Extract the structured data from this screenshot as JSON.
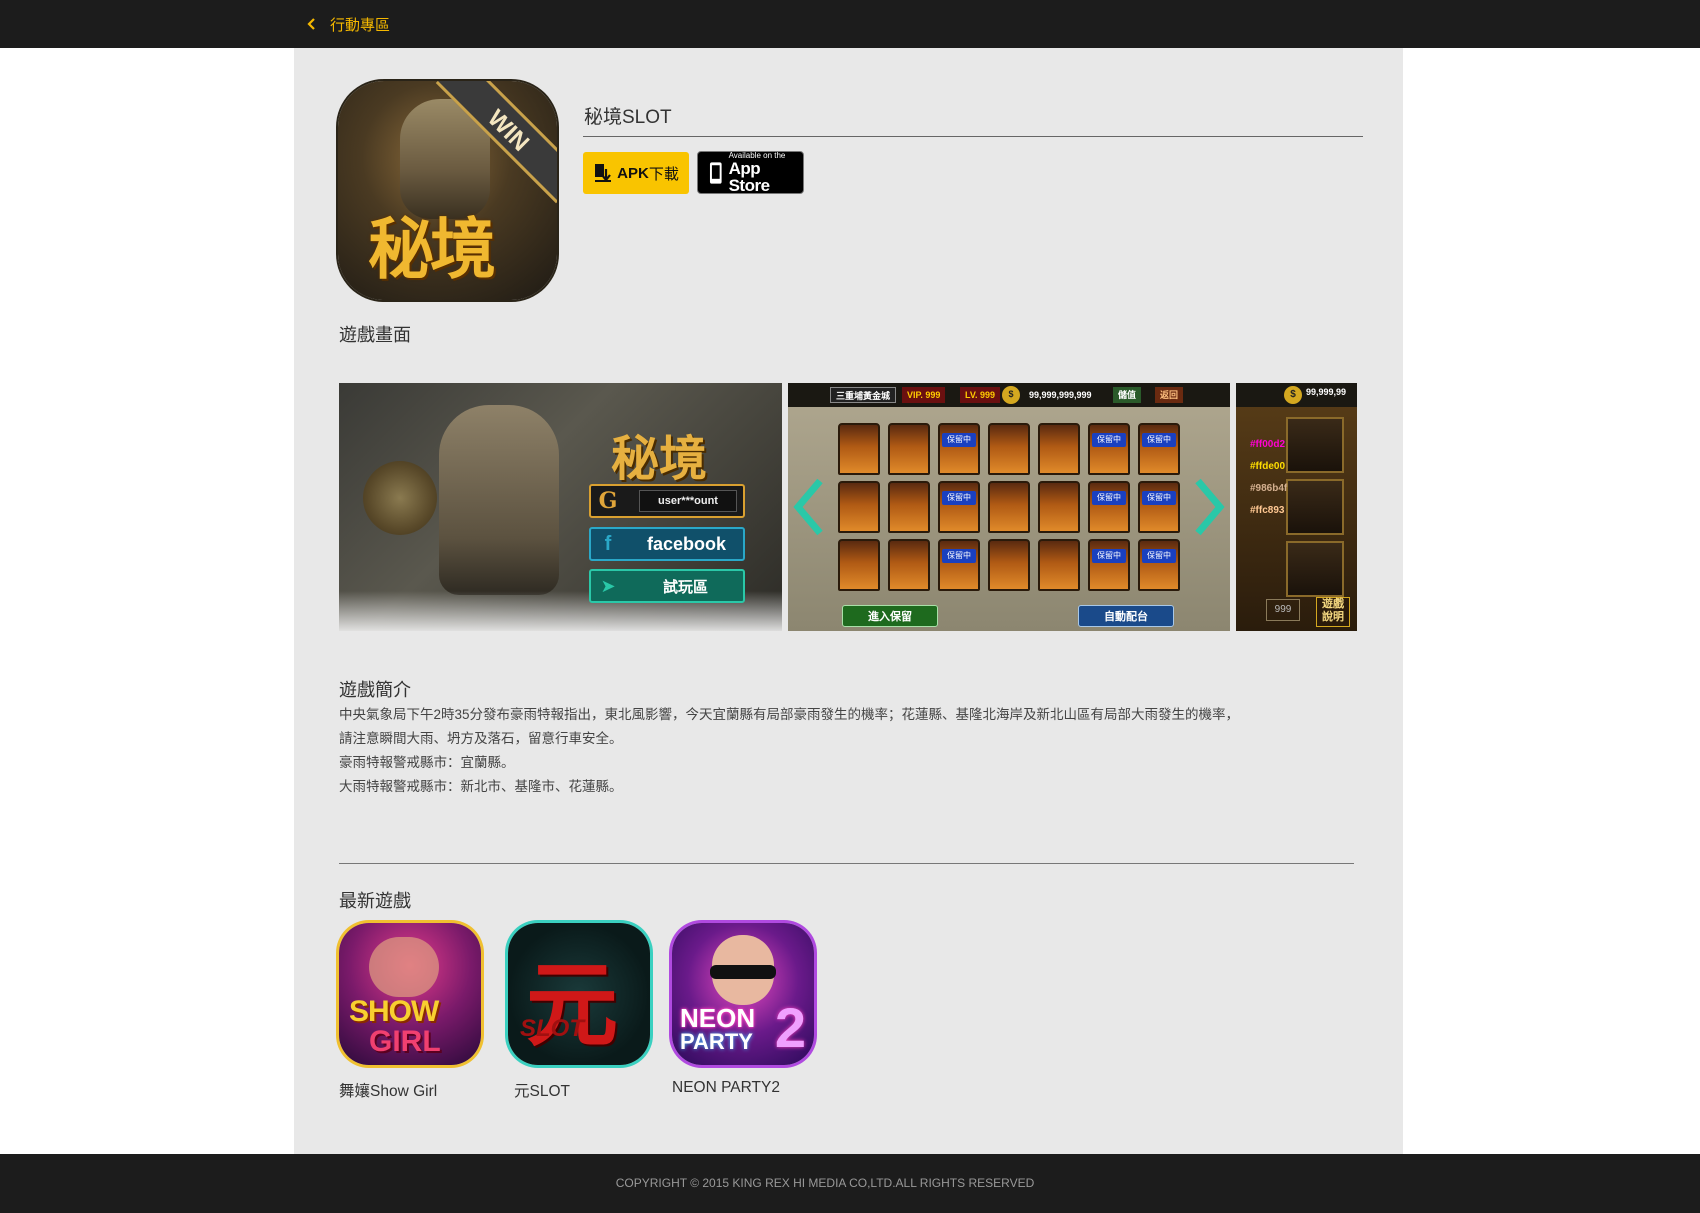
{
  "header": {
    "back_label": "行動專區"
  },
  "app": {
    "title": "秘境SLOT",
    "icon_text": "秘境",
    "icon_banner": "WIN"
  },
  "downloads": {
    "apk_bold": "APK",
    "apk_suffix": "下載",
    "appstore_small": "Available on the",
    "appstore_big": "App Store"
  },
  "screens": {
    "title": "遊戲畫面",
    "shot1": {
      "logo": "秘境",
      "account": "user***ount",
      "facebook": "facebook",
      "trial": "試玩區"
    },
    "shot2": {
      "location": "三重埔黃金城",
      "vip": "VIP. 999",
      "level": "LV. 999",
      "coins": "99,999,999,999",
      "deposit": "儲值",
      "back": "返回",
      "hold_btn": "進入保留",
      "auto_btn": "自動配台"
    },
    "shot3": {
      "coins": "99,999,99",
      "tags": [
        "#ff00d2",
        "#ffde00",
        "#986b4f",
        "#ffc893"
      ],
      "box": "999",
      "info": "遊戲說明"
    }
  },
  "intro": {
    "title": "遊戲簡介",
    "lines": [
      "中央氣象局下午2時35分發布豪雨特報指出，東北風影響，今天宜蘭縣有局部豪雨發生的機率；花蓮縣、基隆北海岸及新北山區有局部大雨發生的機率，",
      "請注意瞬間大雨、坍方及落石，留意行車安全。",
      "豪雨特報警戒縣市：宜蘭縣。",
      "大雨特報警戒縣市：新北市、基隆市、花蓮縣。"
    ]
  },
  "latest": {
    "title": "最新遊戲",
    "games": [
      {
        "name": "舞孃Show Girl",
        "icon_line1": "SHOW",
        "icon_line2": "GIRL"
      },
      {
        "name": "元SLOT",
        "icon_line1": "元",
        "icon_line2": "SLOT"
      },
      {
        "name": "NEON PARTY2",
        "icon_line1": "NEON",
        "icon_line2": "PARTY",
        "icon_line3": "2"
      }
    ]
  },
  "footer": {
    "copyright": "COPYRIGHT © 2015 KING REX HI MEDIA CO,LTD.ALL RIGHTS RESERVED"
  },
  "colors": {
    "accent": "#f9c400",
    "topbar": "#1c1c1c",
    "panel": "#e8e8e8"
  }
}
